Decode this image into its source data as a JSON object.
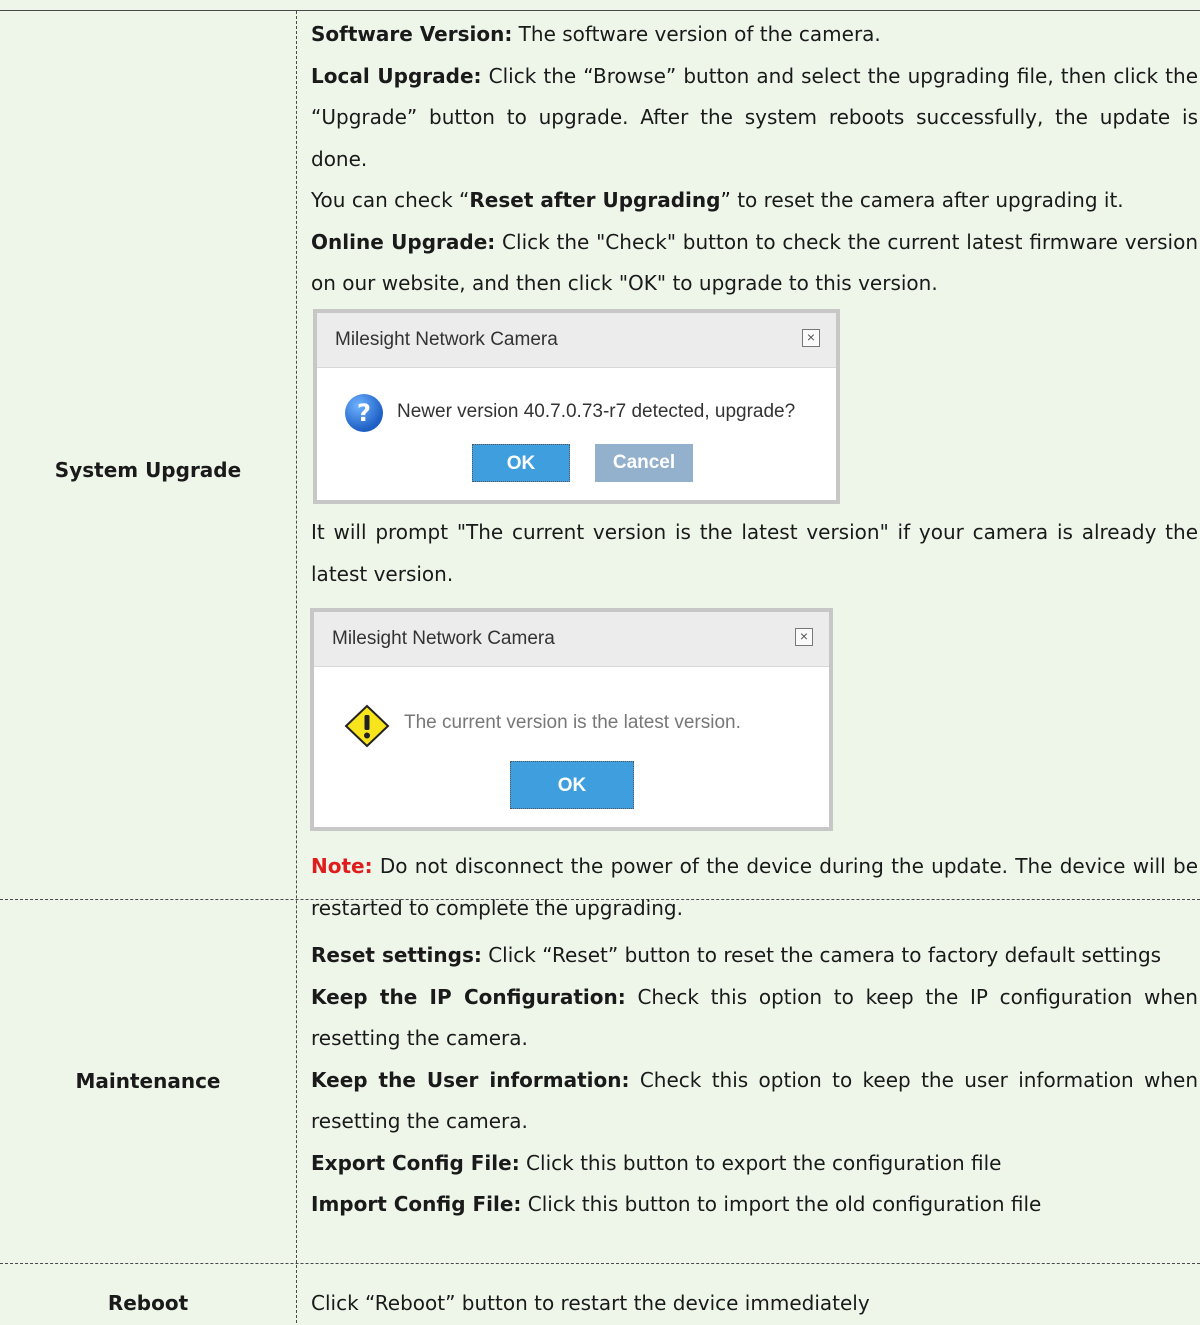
{
  "rows": {
    "system_upgrade": {
      "label": "System Upgrade",
      "software_version": {
        "title": "Software Version:",
        "text": " The software version of the camera."
      },
      "local_upgrade": {
        "title": "Local Upgrade:",
        "text": " Click the “Browse” button and select the upgrading file, then click the “Upgrade” button to upgrade. After the system reboots successfully, the update is done."
      },
      "reset_note": {
        "pre": "You can check “",
        "bold": "Reset after Upgrading",
        "post": "” to reset the camera after upgrading it."
      },
      "online_upgrade": {
        "title": "Online Upgrade:",
        "text": " Click the \"Check\" button to check the current latest firmware version on our website, and then click \"OK\" to upgrade to this version."
      },
      "dialog1": {
        "title": "Milesight Network Camera",
        "message": "Newer version 40.7.0.73-r7 detected, upgrade?",
        "ok": "OK",
        "cancel": "Cancel"
      },
      "prompt_text": "It will prompt \"The current version is the latest version\" if your camera is already the latest version.",
      "dialog2": {
        "title": "Milesight Network Camera",
        "message": "The current version is the latest version.",
        "ok": "OK"
      },
      "note": {
        "label": "Note:",
        "text": " Do not disconnect the power of the device during the update. The device will be restarted to complete the upgrading."
      }
    },
    "maintenance": {
      "label": "Maintenance",
      "items": [
        {
          "title": "Reset settings:",
          "text": " Click “Reset” button to reset the camera to factory default settings"
        },
        {
          "title": "Keep the IP Configuration:",
          "text": " Check this option to keep the IP configuration when resetting the camera."
        },
        {
          "title": "Keep the User information:",
          "text": " Check this option to keep the user information when resetting the camera."
        },
        {
          "title": "Export Config File:",
          "text": " Click this button to export the configuration file"
        },
        {
          "title": "Import Config File:",
          "text": " Click this button to import the old configuration file"
        }
      ]
    },
    "reboot": {
      "label": "Reboot",
      "text": "Click “Reboot” button to restart the device immediately"
    }
  }
}
